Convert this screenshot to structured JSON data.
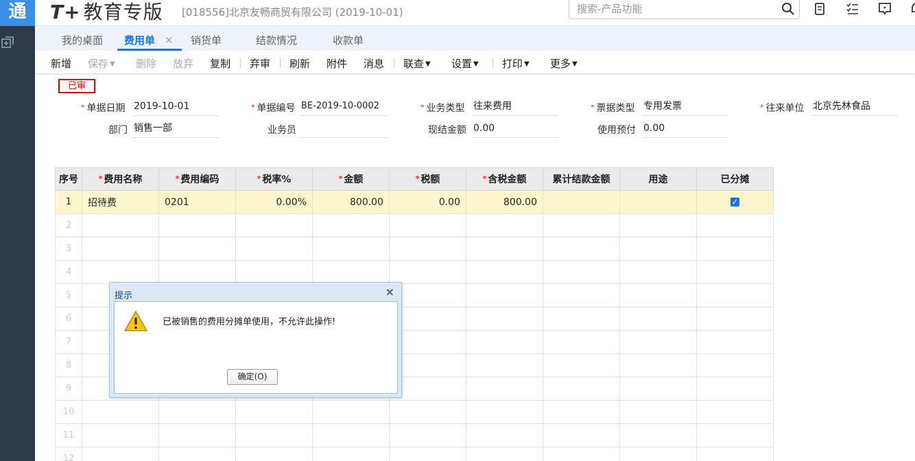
{
  "app": {
    "logo_char": "通",
    "brand_prefix": "T+",
    "brand_name": "教育专版",
    "company": "[018556]北京友畅商贸有限公司   (2019-10-01)"
  },
  "search": {
    "placeholder": "搜索-产品功能"
  },
  "tabs": [
    {
      "label": "我的桌面",
      "active": false
    },
    {
      "label": "费用单",
      "active": true
    },
    {
      "label": "销货单",
      "active": false
    },
    {
      "label": "结款情况",
      "active": false
    },
    {
      "label": "收款单",
      "active": false
    }
  ],
  "tab_close": "×",
  "toolbar": [
    {
      "label": "新增",
      "enabled": true
    },
    {
      "label": "保存",
      "enabled": false
    },
    {
      "label": "删除",
      "enabled": false
    },
    {
      "label": "放弃",
      "enabled": false
    },
    {
      "label": "复制",
      "enabled": true
    },
    {
      "label": "弃审",
      "enabled": true
    },
    {
      "label": "刷新",
      "enabled": true
    },
    {
      "label": "附件",
      "enabled": true
    },
    {
      "label": "消息",
      "enabled": true
    },
    {
      "label": "联查",
      "enabled": true
    },
    {
      "label": "设置",
      "enabled": true
    },
    {
      "label": "打印",
      "enabled": true
    },
    {
      "label": "更多",
      "enabled": true
    }
  ],
  "stamp": "已审",
  "form": {
    "date_label": "单据日期",
    "date": "2019-10-01",
    "code_label": "单据编号",
    "code": "BE-2019-10-0002",
    "biztype_label": "业务类型",
    "biztype": "往来费用",
    "invtype_label": "票据类型",
    "invtype": "专用发票",
    "partner_label": "往来单位",
    "partner": "北京先林食品",
    "dept_label": "部门",
    "dept": "销售一部",
    "clerk_label": "业务员",
    "clerk": "",
    "cash_label": "现结金额",
    "cash": "0.00",
    "prepay_label": "使用预付",
    "prepay": "0.00"
  },
  "grid": {
    "headers": {
      "no": "序号",
      "name": "费用名称",
      "code": "费用编码",
      "rate": "税率%",
      "amount": "金额",
      "tax": "税额",
      "total": "含税金额",
      "settled": "累计结款金额",
      "usage": "用途",
      "allocated": "已分摊"
    },
    "rows": [
      {
        "no": "1",
        "name": "招待费",
        "code": "0201",
        "rate": "0.00%",
        "amount": "800.00",
        "tax": "0.00",
        "total": "800.00",
        "settled": "",
        "usage": "",
        "allocated": true
      },
      {
        "no": "2"
      },
      {
        "no": "3"
      },
      {
        "no": "4"
      },
      {
        "no": "5"
      },
      {
        "no": "6"
      },
      {
        "no": "7"
      },
      {
        "no": "8"
      },
      {
        "no": "9"
      },
      {
        "no": "10"
      },
      {
        "no": "11"
      },
      {
        "no": "12"
      }
    ]
  },
  "dialog": {
    "title": "提示",
    "close": "×",
    "message": "已被销售的费用分摊单使用，不允许此操作!",
    "ok_label": "确定(O)"
  },
  "colors": {
    "accent": "#1a73d9",
    "rail": "#2e3a48",
    "stamp": "#cc0000",
    "selected_row": "#fff5cc"
  }
}
